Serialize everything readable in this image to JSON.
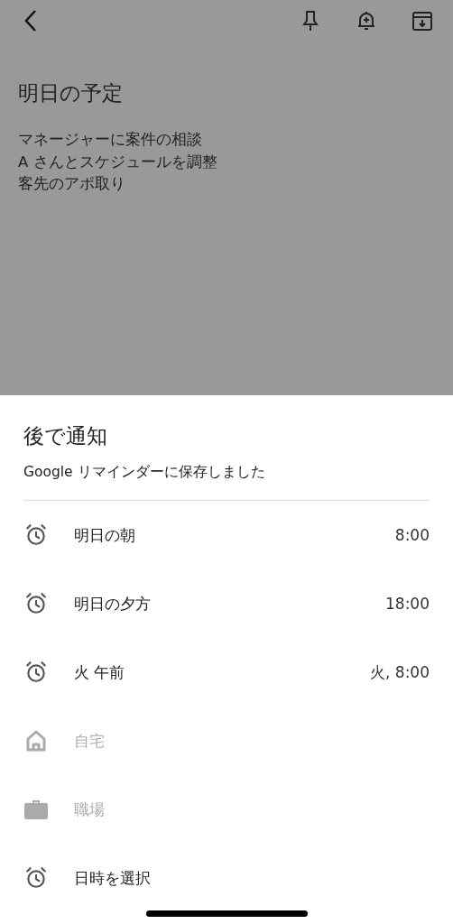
{
  "note": {
    "title": "明日の予定",
    "lines": [
      "マネージャーに案件の相談",
      "A さんとスケジュールを調整",
      "客先のアポ取り"
    ]
  },
  "sheet": {
    "title": "後で通知",
    "subtitle": "Google リマインダーに保存しました",
    "options": [
      {
        "kind": "alarm",
        "label": "明日の朝",
        "time": "8:00",
        "disabled": false
      },
      {
        "kind": "alarm",
        "label": "明日の夕方",
        "time": "18:00",
        "disabled": false
      },
      {
        "kind": "alarm",
        "label": "火 午前",
        "time": "火, 8:00",
        "disabled": false
      },
      {
        "kind": "home",
        "label": "自宅",
        "disabled": true
      },
      {
        "kind": "work",
        "label": "職場",
        "disabled": true
      },
      {
        "kind": "alarm",
        "label": "日時を選択",
        "disabled": false
      }
    ]
  }
}
